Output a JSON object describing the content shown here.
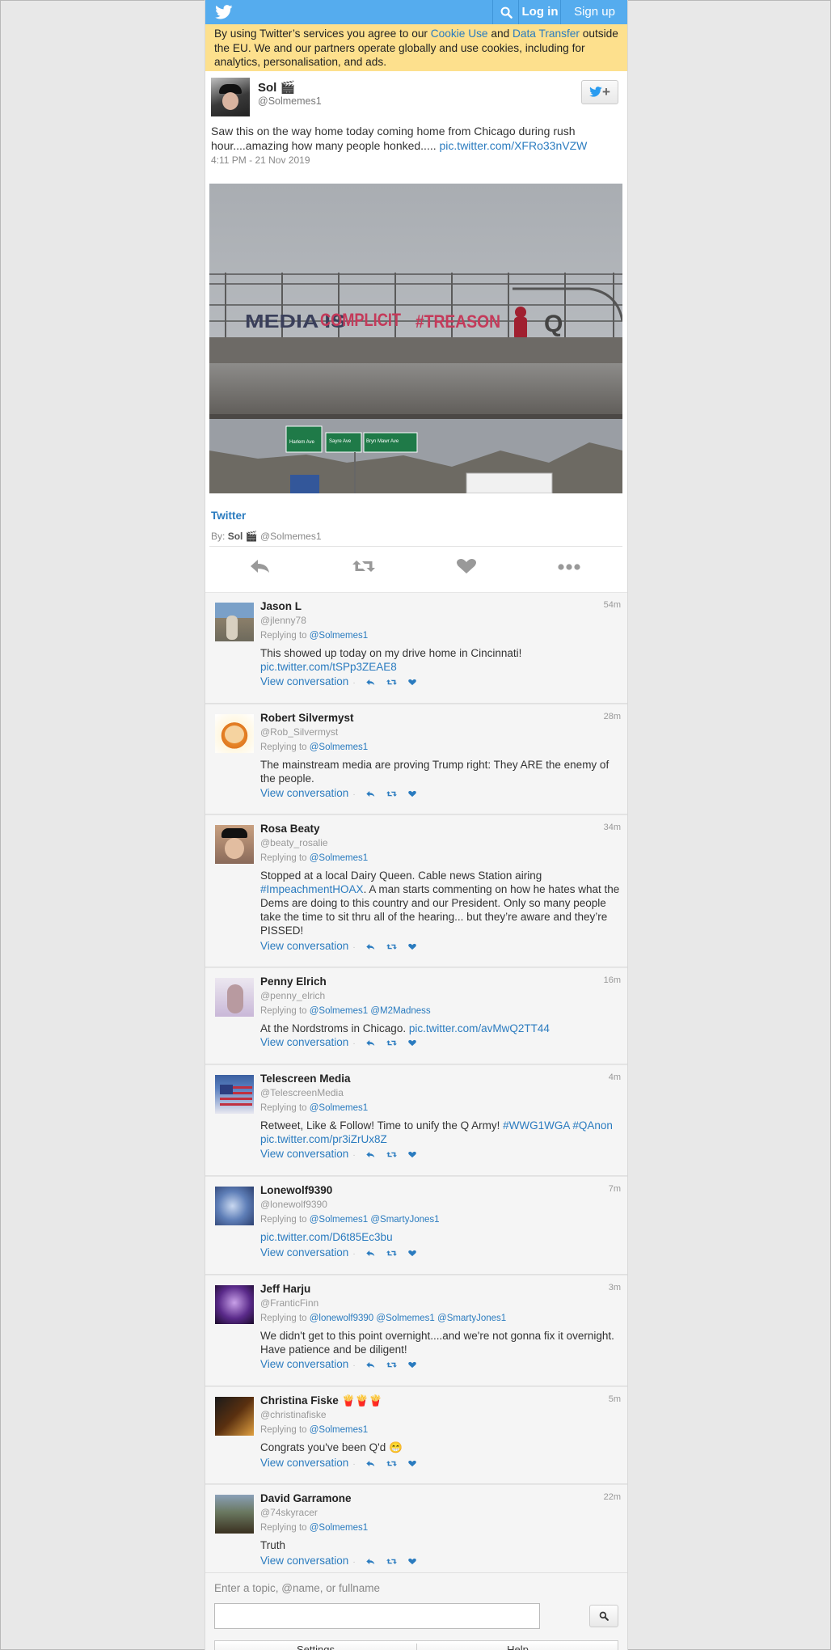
{
  "topbar": {
    "login": "Log in",
    "signup": "Sign up"
  },
  "cookie": {
    "prefix": "By using Twitter’s services you agree to our ",
    "cookie_link": "Cookie Use",
    "and": " and ",
    "data_link": "Data Transfer",
    "suffix": " outside the EU. We and our partners operate globally and use cookies, including for analytics, personalisation, and ads."
  },
  "main_tweet": {
    "name": "Sol 🎬",
    "handle": "@Solmemes1",
    "text": "Saw this on the way home today coming home from Chicago during rush hour....amazing how many people honked..... ",
    "link": "pic.twitter.com/XFRo33nVZW",
    "time": "4:11 PM - 21 Nov 2019",
    "media": {
      "banner_media": "MEDIA IS",
      "banner_complicit": "COMPLICIT",
      "banner_treason": "#TREASON",
      "banner_q": "Q",
      "sign1_title": "Harlem Ave",
      "sign1_sub": "1 mi",
      "sign2_title": "Sayre Ave",
      "sign2_sub": "No Exit",
      "sign3_title": "Bryn Mawr Ave",
      "sign3_sub": "Exit 40",
      "sign1_exit": "EXIT 41A",
      "sign2_exit": "EXIT 41B",
      "sign3_exit": "EXIT 41C"
    },
    "card_name": "Twitter",
    "by_label": "By:",
    "by_name": "Sol 🎬",
    "by_handle": "@Solmemes1"
  },
  "replies": [
    {
      "name": "Jason L",
      "handle": "@jlenny78",
      "time": "54m",
      "replying_label": "Replying to",
      "replying": [
        "@Solmemes1"
      ],
      "text": "This showed up today on my drive home in Cincinnati! ",
      "link": "pic.twitter.com/tSPp3ZEAE8",
      "view": "View conversation"
    },
    {
      "name": "Robert Silvermyst",
      "handle": "@Rob_Silvermyst",
      "time": "28m",
      "replying_label": "Replying to",
      "replying": [
        "@Solmemes1"
      ],
      "text": "The mainstream media are proving Trump right: They ARE the enemy of the people.",
      "link": "",
      "view": "View conversation"
    },
    {
      "name": "Rosa Beaty",
      "handle": "@beaty_rosalie",
      "time": "34m",
      "replying_label": "Replying to",
      "replying": [
        "@Solmemes1"
      ],
      "text_pre": "Stopped at a local Dairy Queen. Cable news Station airing ",
      "hashtag": "#ImpeachmentHOAX",
      "text_post": ". A man starts commenting on how he hates what the Dems are doing to this country and our President. Only so many people take the time to sit thru all of the hearing... but they’re aware and they’re PISSED!",
      "view": "View conversation"
    },
    {
      "name": "Penny Elrich",
      "handle": "@penny_elrich",
      "time": "16m",
      "replying_label": "Replying to",
      "replying": [
        "@Solmemes1",
        "@M2Madness"
      ],
      "text": "At the Nordstroms in Chicago. ",
      "link": "pic.twitter.com/avMwQ2TT44",
      "view": "View conversation"
    },
    {
      "name": "Telescreen Media",
      "handle": "@TelescreenMedia",
      "time": "4m",
      "replying_label": "Replying to",
      "replying": [
        "@Solmemes1"
      ],
      "text": "Retweet, Like & Follow! Time to unify the Q Army! ",
      "hashtag1": "#WWG1WGA",
      "hashtag2": "#QAnon",
      "link": "pic.twitter.com/pr3iZrUx8Z",
      "view": "View conversation"
    },
    {
      "name": "Lonewolf9390",
      "handle": "@lonewolf9390",
      "time": "7m",
      "replying_label": "Replying to",
      "replying": [
        "@Solmemes1",
        "@SmartyJones1"
      ],
      "link": "pic.twitter.com/D6t85Ec3bu",
      "view": "View conversation"
    },
    {
      "name": "Jeff Harju",
      "handle": "@FranticFinn",
      "time": "3m",
      "replying_label": "Replying to",
      "replying": [
        "@lonewolf9390",
        "@Solmemes1",
        "@SmartyJones1"
      ],
      "text": "We didn't get to this point overnight....and we're not gonna fix it overnight. Have patience and be diligent!",
      "view": "View conversation"
    },
    {
      "name": "Christina Fiske 🍟🍟🍟",
      "handle": "@christinafiske",
      "time": "5m",
      "replying_label": "Replying to",
      "replying": [
        "@Solmemes1"
      ],
      "text": "Congrats you've been Q'd 😁",
      "view": "View conversation"
    },
    {
      "name": "David Garramone",
      "handle": "@74skyracer",
      "time": "22m",
      "replying_label": "Replying to",
      "replying": [
        "@Solmemes1"
      ],
      "text": "Truth",
      "view": "View conversation"
    }
  ],
  "search": {
    "label": "Enter a topic, @name, or fullname",
    "value": ""
  },
  "bottom_tabs": [
    "Settings",
    "Help"
  ],
  "colors": {
    "accent": "#55acee",
    "link": "#2a7bbf",
    "cookie_bg": "#fde08d"
  }
}
